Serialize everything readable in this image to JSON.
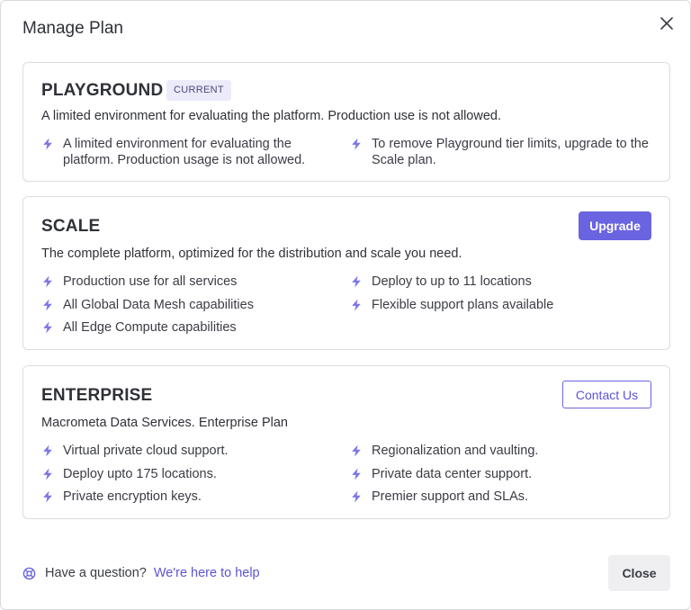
{
  "dialog": {
    "title": "Manage Plan"
  },
  "plans": {
    "playground": {
      "name": "PLAYGROUND",
      "badge": "CURRENT",
      "description": "A limited environment for evaluating the platform. Production use is not allowed.",
      "features_left": [
        "A limited environment for evaluating the platform. Production usage is not allowed."
      ],
      "features_right": [
        "To remove Playground tier limits, upgrade to the Scale plan."
      ]
    },
    "scale": {
      "name": "SCALE",
      "button": "Upgrade",
      "description": "The complete platform, optimized for the distribution and scale you need.",
      "features_left": [
        "Production use for all services",
        "All Global Data Mesh capabilities",
        "All Edge Compute capabilities"
      ],
      "features_right": [
        "Deploy to up to 11 locations",
        "Flexible support plans available"
      ]
    },
    "enterprise": {
      "name": "ENTERPRISE",
      "button": "Contact Us",
      "description": "Macrometa Data Services. Enterprise Plan",
      "features_left": [
        "Virtual private cloud support.",
        "Deploy upto 175 locations.",
        "Private encryption keys."
      ],
      "features_right": [
        "Regionalization and vaulting.",
        "Private data center support.",
        "Premier support and SLAs."
      ]
    }
  },
  "footer": {
    "question": "Have a question?",
    "help_link": "We're here to help",
    "close_button": "Close"
  },
  "icons": {
    "feature": "lightning-bolt-icon",
    "help": "lifebuoy-icon",
    "close": "close-icon"
  },
  "colors": {
    "accent": "#6a64e0",
    "bolt": "#7b76e6",
    "badge_bg": "#ebebfa"
  }
}
